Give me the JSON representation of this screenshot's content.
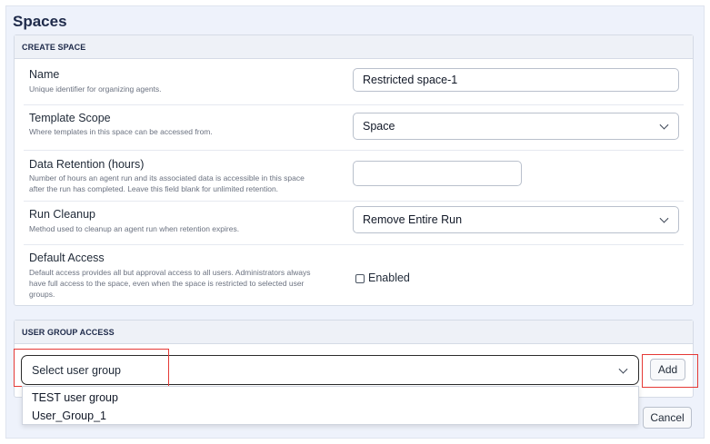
{
  "page": {
    "title": "Spaces"
  },
  "create_space": {
    "header": "CREATE SPACE",
    "name": {
      "label": "Name",
      "description": "Unique identifier for organizing agents.",
      "value": "Restricted space-1"
    },
    "template_scope": {
      "label": "Template Scope",
      "description": "Where templates in this space can be accessed from.",
      "value": "Space"
    },
    "data_retention": {
      "label": "Data Retention (hours)",
      "description_line1": "Number of hours an agent run and its associated data is accessible in this space",
      "description_line2": "after the run has completed. Leave this field blank for unlimited retention.",
      "value": ""
    },
    "run_cleanup": {
      "label": "Run Cleanup",
      "description": "Method used to cleanup an agent run when retention expires.",
      "value": "Remove Entire Run"
    },
    "default_access": {
      "label": "Default Access",
      "description_line1": "Default access provides all but approval access to all users. Administrators always",
      "description_line2": "have full access to the space, even when the space is restricted to selected user",
      "description_line3": "groups.",
      "checkbox_label": "Enabled",
      "checked": false
    }
  },
  "user_group_access": {
    "header": "USER GROUP ACCESS",
    "select_placeholder": "Select user group",
    "add_label": "Add",
    "options": [
      "TEST user group",
      "User_Group_1"
    ]
  },
  "footer": {
    "cancel_label": "Cancel"
  },
  "colors": {
    "highlight": "#e53935",
    "primary": "#5b5be0"
  }
}
